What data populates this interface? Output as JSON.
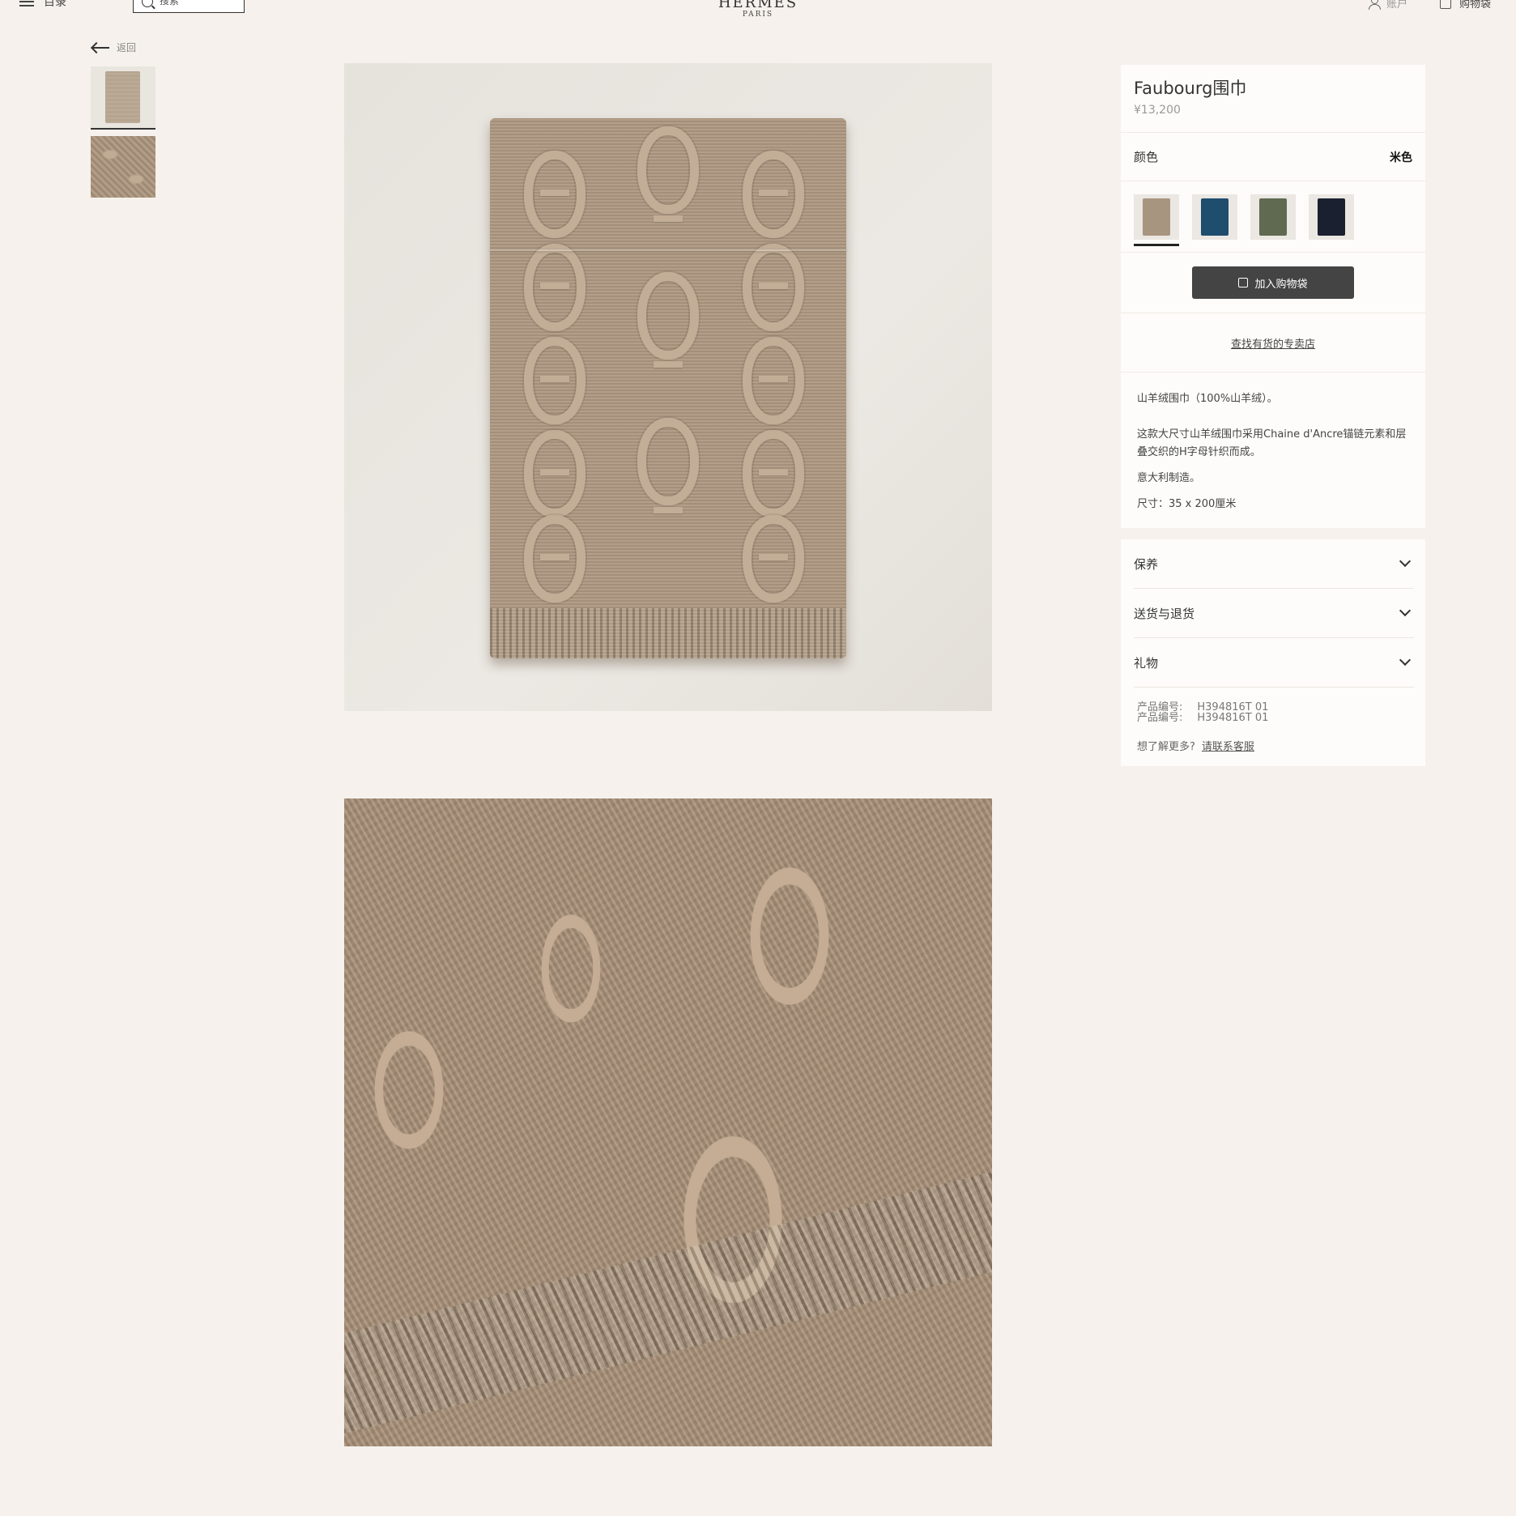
{
  "header": {
    "menu_label": "目录",
    "search_placeholder": "搜索",
    "logo_brand": "HERMES",
    "logo_city": "PARIS",
    "account_label": "账户",
    "bag_label": "购物袋"
  },
  "nav": {
    "back_label": "返回"
  },
  "product": {
    "name": "Faubourg围巾",
    "price": "¥13,200",
    "color_label": "颜色",
    "color_value": "米色",
    "swatches": [
      {
        "name": "beige",
        "color": "#a89580"
      },
      {
        "name": "blue",
        "color": "#1e4d6e"
      },
      {
        "name": "green",
        "color": "#5f6a50"
      },
      {
        "name": "navy",
        "color": "#1a2030"
      }
    ],
    "add_to_cart": "加入购物袋",
    "find_store": "查找有货的专卖店",
    "description": {
      "material": "山羊绒围巾（100%山羊绒）。",
      "details": "这款大尺寸山羊绒围巾采用Chaine d'Ancre锚链元素和层叠交织的H字母针织而成。",
      "origin": "意大利制造。",
      "size": "尺寸：35 x 200厘米"
    },
    "accordions": [
      "保养",
      "送货与退货",
      "礼物"
    ],
    "sku_label": "产品编号:",
    "sku_value": "H394816T 01",
    "help_text": "想了解更多?",
    "help_link": "请联系客服"
  }
}
